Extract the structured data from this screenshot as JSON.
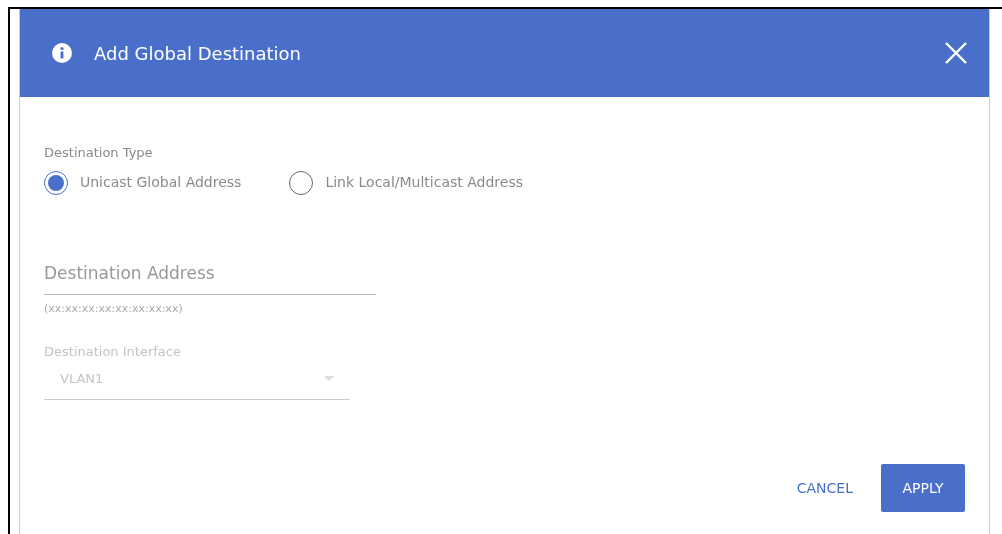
{
  "dialog": {
    "title": "Add Global Destination"
  },
  "destination_type": {
    "label": "Destination Type",
    "options": [
      {
        "label": "Unicast Global Address",
        "selected": true
      },
      {
        "label": "Link Local/Multicast Address",
        "selected": false
      }
    ]
  },
  "destination_address": {
    "placeholder": "Destination Address",
    "hint": "(xx:xx:xx:xx:xx:xx:xx:xx)"
  },
  "destination_interface": {
    "label": "Destination Interface",
    "value": "VLAN1",
    "disabled": true
  },
  "buttons": [
    {
      "label": "CANCEL",
      "kind": "link"
    },
    {
      "label": "APPLY",
      "kind": "primary"
    }
  ]
}
